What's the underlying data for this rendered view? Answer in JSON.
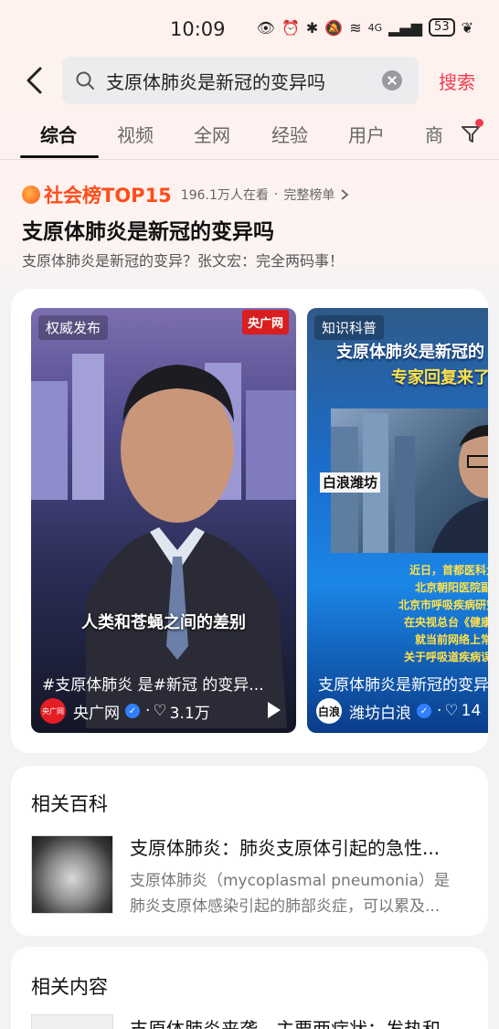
{
  "status_bar": {
    "time": "10:09",
    "network": "4G",
    "battery": "53"
  },
  "search": {
    "query": "支原体肺炎是新冠的变异吗",
    "button_label": "搜索"
  },
  "tabs": [
    {
      "label": "综合",
      "active": true
    },
    {
      "label": "视频"
    },
    {
      "label": "全网"
    },
    {
      "label": "经验"
    },
    {
      "label": "用户"
    },
    {
      "label": "商"
    }
  ],
  "hot": {
    "rank_label": "社会榜TOP15",
    "viewers": "196.1万人在看",
    "separator": "·",
    "full_list_link": "完整榜单",
    "title": "支原体肺炎是新冠的变异吗",
    "subtitle": "支原体肺炎是新冠的变异？张文宏：完全两码事！"
  },
  "videos": [
    {
      "tag": "权威发布",
      "brand_badge": "央广网",
      "caption": "人类和苍蝇之间的差别",
      "title": "#支原体肺炎 是#新冠 的变异...",
      "author": "央广网",
      "avatar_text": "央广网",
      "likes": "3.1万"
    },
    {
      "tag": "知识科普",
      "headline_1": "支原体肺炎是新冠的",
      "headline_2": "专家回复来了",
      "stamp": "白浪潍坊",
      "lines": [
        "近日，首都医科大学附",
        "北京朝阳医院副院长",
        "北京市呼吸疾病研究所所长",
        "在央视总台《健康中国》",
        "就当前网络上常见的",
        "关于呼吸道疾病误区进行"
      ],
      "title": "支原体肺炎是新冠的变异",
      "author": "潍坊白浪",
      "avatar_text": "白浪",
      "likes": "14"
    }
  ],
  "baike": {
    "section_title": "相关百科",
    "item_title": "支原体肺炎：肺炎支原体引起的急性...",
    "desc_line_1": "支原体肺炎（mycoplasmal pneumonia）是",
    "desc_line_2": "肺炎支原体感染引起的肺部炎症，可以累及..."
  },
  "related": {
    "section_title": "相关内容",
    "item_title": "支原体肺炎来袭，主要两症状：发热和"
  },
  "colors": {
    "accent": "#f33b4d",
    "hot": "#ff4d1a",
    "verified": "#2f80ff"
  }
}
